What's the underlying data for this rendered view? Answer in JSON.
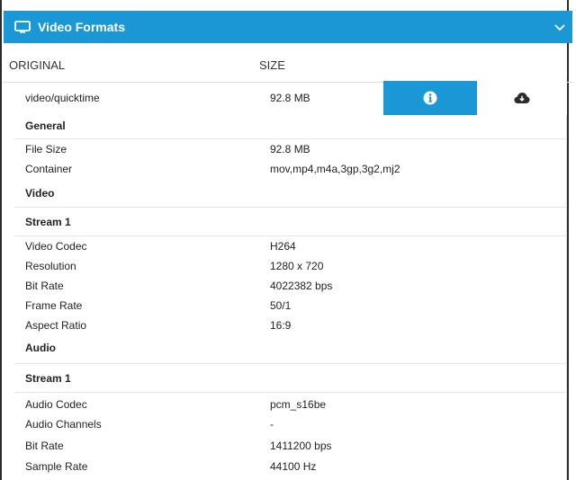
{
  "panel": {
    "title": "Video Formats"
  },
  "columns": {
    "original": "ORIGINAL",
    "size": "SIZE"
  },
  "file": {
    "mime": "video/quicktime",
    "size": "92.8 MB"
  },
  "sections": {
    "general": {
      "title": "General",
      "rows": [
        {
          "key": "File Size",
          "value": "92.8 MB"
        },
        {
          "key": "Container",
          "value": "mov,mp4,m4a,3gp,3g2,mj2"
        }
      ]
    },
    "video": {
      "title": "Video",
      "stream_title": "Stream 1",
      "rows": [
        {
          "key": "Video Codec",
          "value": "H264"
        },
        {
          "key": "Resolution",
          "value": "1280 x 720"
        },
        {
          "key": "Bit Rate",
          "value": "4022382 bps"
        },
        {
          "key": "Frame Rate",
          "value": "50/1"
        },
        {
          "key": "Aspect Ratio",
          "value": "16:9"
        }
      ]
    },
    "audio": {
      "title": "Audio",
      "stream_title": "Stream 1",
      "rows": [
        {
          "key": "Audio Codec",
          "value": "pcm_s16be"
        },
        {
          "key": "Audio Channels",
          "value": "-"
        },
        {
          "key": "Bit Rate",
          "value": "1411200 bps"
        },
        {
          "key": "Sample Rate",
          "value": "44100 Hz"
        }
      ]
    }
  },
  "icons": {
    "panel": "monitor-icon",
    "collapse": "chevron-down-icon",
    "info": "info-icon",
    "download": "cloud-download-icon"
  },
  "colors": {
    "accent": "#1a98d5"
  }
}
